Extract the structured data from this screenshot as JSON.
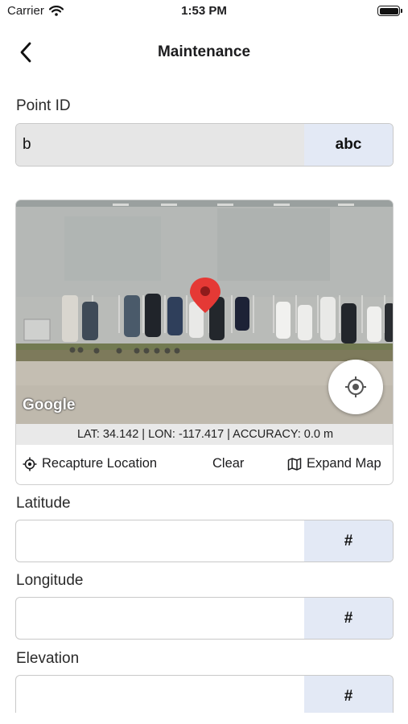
{
  "status_bar": {
    "carrier": "Carrier",
    "time": "1:53 PM"
  },
  "nav": {
    "title": "Maintenance"
  },
  "point_id": {
    "label": "Point ID",
    "value": "b",
    "keyboard_type": "abc"
  },
  "map": {
    "logo": "Google",
    "coordinates_text": "LAT: 34.142 | LON: -117.417 | ACCURACY: 0.0 m",
    "marker_color": "#e53935",
    "recapture_label": "Recapture Location",
    "clear_label": "Clear",
    "expand_label": "Expand Map"
  },
  "fields": {
    "latitude": {
      "label": "Latitude",
      "value": "",
      "keyboard_type": "#"
    },
    "longitude": {
      "label": "Longitude",
      "value": "",
      "keyboard_type": "#"
    },
    "elevation": {
      "label": "Elevation",
      "value": "",
      "keyboard_type": "#"
    }
  },
  "colors": {
    "suffix_bg": "#e3e9f5",
    "filled_input_bg": "#e6e6e6"
  },
  "icons": [
    "wifi-icon",
    "battery-icon",
    "back-chevron-icon",
    "map-pin-icon",
    "locate-icon",
    "crosshair-icon",
    "map-icon"
  ]
}
